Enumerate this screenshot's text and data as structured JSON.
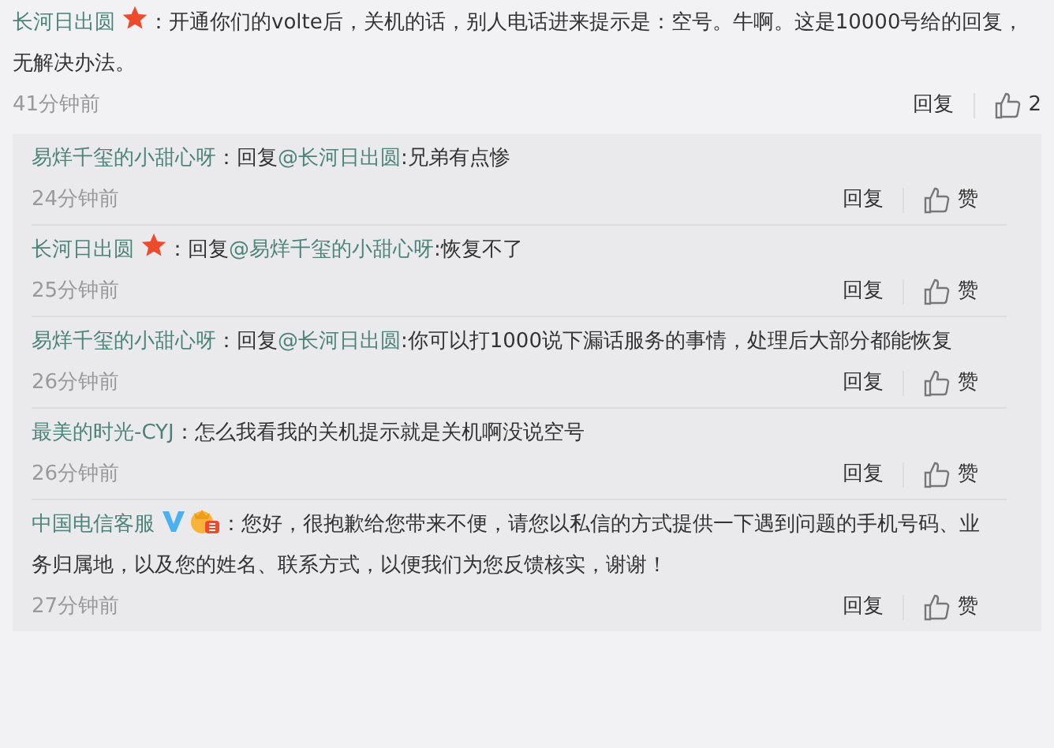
{
  "comment": {
    "user": "长河日出圆",
    "badges": [
      {
        "kind": "star"
      }
    ],
    "separator": "：",
    "text": "开通你们的volte后，关机的话，别人电话进来提示是：空号。牛啊。这是10000号给的回复，无解决办法。",
    "time": "41分钟前",
    "reply_label": "回复",
    "like_label": "2"
  },
  "replies": [
    {
      "user": "易烊千玺的小甜心呀",
      "separator": "：",
      "prefix": "回复",
      "mention": "@长河日出圆",
      "text": ":兄弟有点惨",
      "time": "24分钟前",
      "reply_label": "回复",
      "like_label": "赞"
    },
    {
      "user": "长河日出圆",
      "badges": [
        {
          "kind": "star"
        }
      ],
      "separator": "：",
      "prefix": "回复",
      "mention": "@易烊千玺的小甜心呀",
      "text": ":恢复不了",
      "time": "25分钟前",
      "reply_label": "回复",
      "like_label": "赞"
    },
    {
      "user": "易烊千玺的小甜心呀",
      "separator": "：",
      "prefix": "回复",
      "mention": "@长河日出圆",
      "text": ":你可以打1000说下漏话服务的事情，处理后大部分都能恢复",
      "time": "26分钟前",
      "reply_label": "回复",
      "like_label": "赞"
    },
    {
      "user": "最美的时光-CYJ",
      "separator": "：",
      "text": "怎么我看我的关机提示就是关机啊没说空号",
      "time": "26分钟前",
      "reply_label": "回复",
      "like_label": "赞"
    },
    {
      "user": "中国电信客服",
      "badges": [
        {
          "kind": "verified"
        },
        {
          "kind": "crown"
        }
      ],
      "separator": "：",
      "text": "您好，很抱歉给您带来不便，请您以私信的方式提供一下遇到问题的手机号码、业务归属地，以及您的姓名、联系方式，以便我们为您反馈核实，谢谢！",
      "time": "27分钟前",
      "reply_label": "回复",
      "like_label": "赞"
    }
  ]
}
